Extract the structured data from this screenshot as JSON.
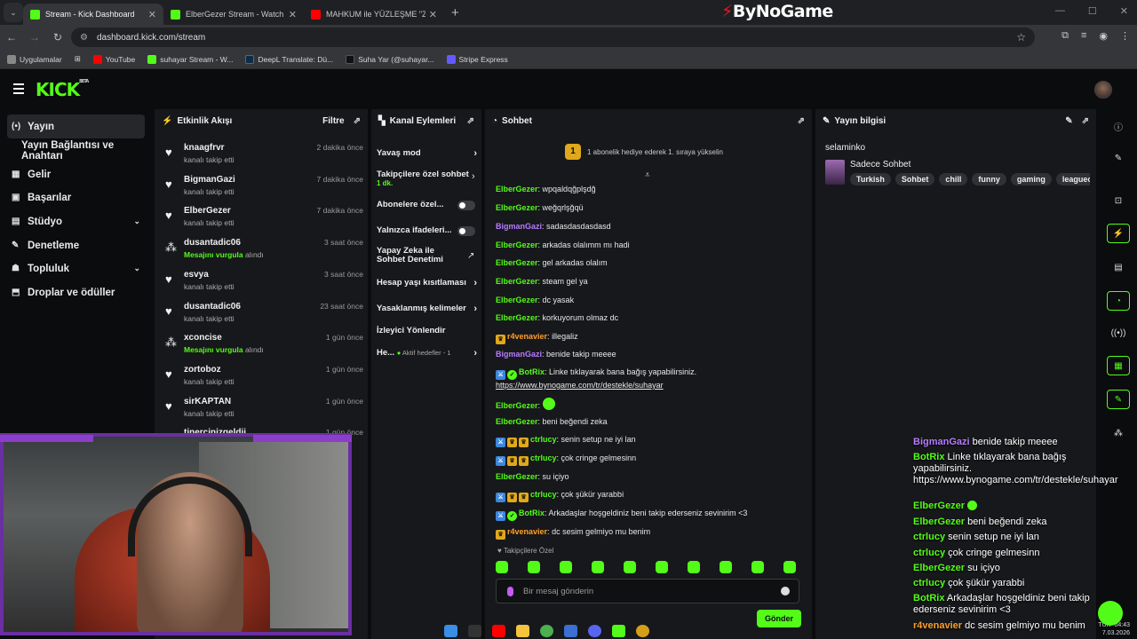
{
  "browser": {
    "tabs": [
      {
        "title": "Stream - Kick Dashboard",
        "color": "#53fc18"
      },
      {
        "title": "ElberGezer Stream - Watch Live",
        "color": "#53fc18"
      },
      {
        "title": "MAHKUM ile YÜZLEŞME \"Zama",
        "color": "#ff0000"
      }
    ],
    "overlay_brand": "ByNoGame",
    "url": "dashboard.kick.com/stream",
    "bookmarks": [
      {
        "label": "Uygulamalar",
        "color": "#888888"
      },
      {
        "label": "YouTube",
        "color": "#ff0000"
      },
      {
        "label": "suhayar Stream - W...",
        "color": "#53fc18"
      },
      {
        "label": "DeepL Translate: Dü...",
        "color": "#0f2b46"
      },
      {
        "label": "Suha Yar (@suhayar...",
        "color": "#111111"
      },
      {
        "label": "Stripe Express",
        "color": "#635bff"
      }
    ]
  },
  "kick": {
    "logo": "KICK",
    "logo_tag": "BETA",
    "accent": "#53fc18"
  },
  "leftnav": [
    {
      "label": "Yayın",
      "icon": "broadcast-icon",
      "glyph": "(•)",
      "active": true
    },
    {
      "label": "Yayın Bağlantısı ve Anahtarı",
      "icon": "",
      "glyph": "",
      "active": false
    },
    {
      "label": "Gelir",
      "icon": "revenue-icon",
      "glyph": "▦",
      "active": false
    },
    {
      "label": "Başarılar",
      "icon": "achievements-icon",
      "glyph": "▣",
      "active": false
    },
    {
      "label": "Stüdyo",
      "icon": "studio-icon",
      "glyph": "▤",
      "active": false,
      "expand": true
    },
    {
      "label": "Denetleme",
      "icon": "wrench-icon",
      "glyph": "✎",
      "active": false
    },
    {
      "label": "Topluluk",
      "icon": "community-icon",
      "glyph": "☗",
      "active": false,
      "expand": true
    },
    {
      "label": "Droplar ve ödüller",
      "icon": "drops-icon",
      "glyph": "⬒",
      "active": false
    }
  ],
  "activity": {
    "title": "Etkinlik Akışı",
    "filter": "Filtre",
    "items": [
      {
        "name": "knaagfrvr",
        "sub": "kanalı takip etti",
        "time": "2 dakika önce",
        "type": "follow"
      },
      {
        "name": "BigmanGazi",
        "sub": "kanalı takip etti",
        "time": "7 dakika önce",
        "type": "follow"
      },
      {
        "name": "ElberGezer",
        "sub": "kanalı takip etti",
        "time": "7 dakika önce",
        "type": "follow"
      },
      {
        "name": "dusantadic06",
        "sub_highlight": "Mesajını vurgula",
        "sub": " alındı",
        "time": "3 saat önce",
        "type": "highlight"
      },
      {
        "name": "esvya",
        "sub": "kanalı takip etti",
        "time": "3 saat önce",
        "type": "follow"
      },
      {
        "name": "dusantadic06",
        "sub": "kanalı takip etti",
        "time": "23 saat önce",
        "type": "follow"
      },
      {
        "name": "xconcise",
        "sub_highlight": "Mesajını vurgula",
        "sub": " alındı",
        "time": "1 gün önce",
        "type": "highlight"
      },
      {
        "name": "zortoboz",
        "sub": "kanalı takip etti",
        "time": "1 gün önce",
        "type": "follow"
      },
      {
        "name": "sirKAPTAN",
        "sub": "kanalı takip etti",
        "time": "1 gün önce",
        "type": "follow"
      },
      {
        "name": "tinercinizgeldii",
        "sub": "",
        "time": "1 gün önce",
        "type": "follow"
      }
    ]
  },
  "channel_actions": {
    "title": "Kanal Eylemleri",
    "items": [
      {
        "label": "Yavaş mod",
        "control": "arrow"
      },
      {
        "label": "Takipçilere özel sohbet",
        "sub": "1 dk.",
        "control": "arrow"
      },
      {
        "label": "Abonelere özel...",
        "control": "toggle"
      },
      {
        "label": "Yalnızca ifadeleri...",
        "control": "toggle"
      },
      {
        "label": "Yapay Zeka ile Sohbet Denetimi",
        "control": "external"
      },
      {
        "label": "Hesap yaşı kısıtlaması",
        "control": "arrow"
      },
      {
        "label": "Yasaklanmış kelimeler",
        "control": "arrow"
      },
      {
        "label": "İzleyici Yönlendir",
        "control": "none"
      },
      {
        "label": "He...",
        "sub": "Aktif hedefler - 1",
        "control": "arrow"
      }
    ]
  },
  "chat": {
    "title": "Sohbet",
    "sub_promo": "1 abonelik hediye ederek 1. sıraya yükselin",
    "sub_promo_num": "1",
    "followers_only_label": "Takipçilere Özel",
    "input_placeholder": "Bir mesaj gönderin",
    "send_label": "Gönder",
    "colors": {
      "green": "#53fc18",
      "purple": "#b67bff",
      "orange": "#ff9f2a"
    },
    "messages": [
      {
        "user": "ElberGezer",
        "color": "green",
        "text": "wpqaldqğplşdğ",
        "badges": []
      },
      {
        "user": "ElberGezer",
        "color": "green",
        "text": "weğqrlşğqü",
        "badges": []
      },
      {
        "user": "BigmanGazi",
        "color": "purple",
        "text": "sadasdasdasdasd",
        "badges": []
      },
      {
        "user": "ElberGezer",
        "color": "green",
        "text": "arkadas olalımm mı hadi",
        "badges": []
      },
      {
        "user": "ElberGezer",
        "color": "green",
        "text": "gel arkadas olalım",
        "badges": []
      },
      {
        "user": "ElberGezer",
        "color": "green",
        "text": "steam gel ya",
        "badges": []
      },
      {
        "user": "ElberGezer",
        "color": "green",
        "text": "dc yasak",
        "badges": []
      },
      {
        "user": "ElberGezer",
        "color": "green",
        "text": "korkuyorum olmaz dc",
        "badges": []
      },
      {
        "user": "r4venavier",
        "color": "orange",
        "text": "illegaliz",
        "badges": [
          "crown"
        ]
      },
      {
        "user": "BigmanGazi",
        "color": "purple",
        "text": "benide takip meeee",
        "badges": []
      },
      {
        "user": "BotRix",
        "color": "green",
        "text": "Linke tıklayarak bana bağış yapabilirsiniz.",
        "link": "https://www.bynogame.com/tr/destekle/suhayar",
        "badges": [
          "mod",
          "ver"
        ]
      },
      {
        "user": "ElberGezer",
        "color": "green",
        "text": "",
        "badges": [],
        "emote": true
      },
      {
        "user": "ElberGezer",
        "color": "green",
        "text": "beni beğendi zeka",
        "badges": []
      },
      {
        "user": "ctrlucy",
        "color": "green",
        "text": "senin setup ne iyi lan",
        "badges": [
          "mod",
          "crown",
          "crown"
        ]
      },
      {
        "user": "ctrlucy",
        "color": "green",
        "text": "çok cringe gelmesinn",
        "badges": [
          "mod",
          "crown",
          "crown"
        ]
      },
      {
        "user": "ElberGezer",
        "color": "green",
        "text": "su içiyo",
        "badges": []
      },
      {
        "user": "ctrlucy",
        "color": "green",
        "text": "çok şükür yarabbi",
        "badges": [
          "mod",
          "crown",
          "crown"
        ]
      },
      {
        "user": "BotRix",
        "color": "green",
        "text": "Arkadaşlar hoşgeldiniz beni takip ederseniz sevinirim <3",
        "badges": [
          "mod",
          "ver"
        ]
      },
      {
        "user": "r4venavier",
        "color": "orange",
        "text": "dc sesim gelmiyo mu benim",
        "badges": [
          "crown"
        ]
      }
    ]
  },
  "stream_info": {
    "title": "Yayın bilgisi",
    "stream_title": "selaminko",
    "category": "Sadece Sohbet",
    "tags": [
      "Turkish",
      "Sohbet",
      "chill",
      "funny",
      "gaming",
      "leagueofle"
    ]
  },
  "overlay_chat": [
    {
      "user": "BigmanGazi",
      "color": "#b67bff",
      "text": "benide takip meeee"
    },
    {
      "user": "BotRix",
      "color": "#53fc18",
      "text": "Linke tıklayarak bana bağış yapabilirsiniz. https://www.bynogame.com/tr/destekle/suhayar"
    },
    {
      "user": "ElberGezer",
      "color": "#53fc18",
      "text": "",
      "emote": true
    },
    {
      "user": "ElberGezer",
      "color": "#53fc18",
      "text": "beni beğendi zeka"
    },
    {
      "user": "ctrlucy",
      "color": "#53fc18",
      "text": "senin setup ne iyi lan"
    },
    {
      "user": "ctrlucy",
      "color": "#53fc18",
      "text": "çok cringe gelmesinn"
    },
    {
      "user": "ElberGezer",
      "color": "#53fc18",
      "text": "su içiyo"
    },
    {
      "user": "ctrlucy",
      "color": "#53fc18",
      "text": "çok şükür yarabbi"
    },
    {
      "user": "BotRix",
      "color": "#53fc18",
      "text": "Arkadaşlar hoşgeldiniz beni takip ederseniz sevinirim <3"
    },
    {
      "user": "r4venavier",
      "color": "#ff9f2a",
      "text": "dc sesim gelmiyo mu benim"
    }
  ],
  "system_tray": {
    "lang": "TUR",
    "time": "04:43",
    "date": "7.03.2026"
  }
}
